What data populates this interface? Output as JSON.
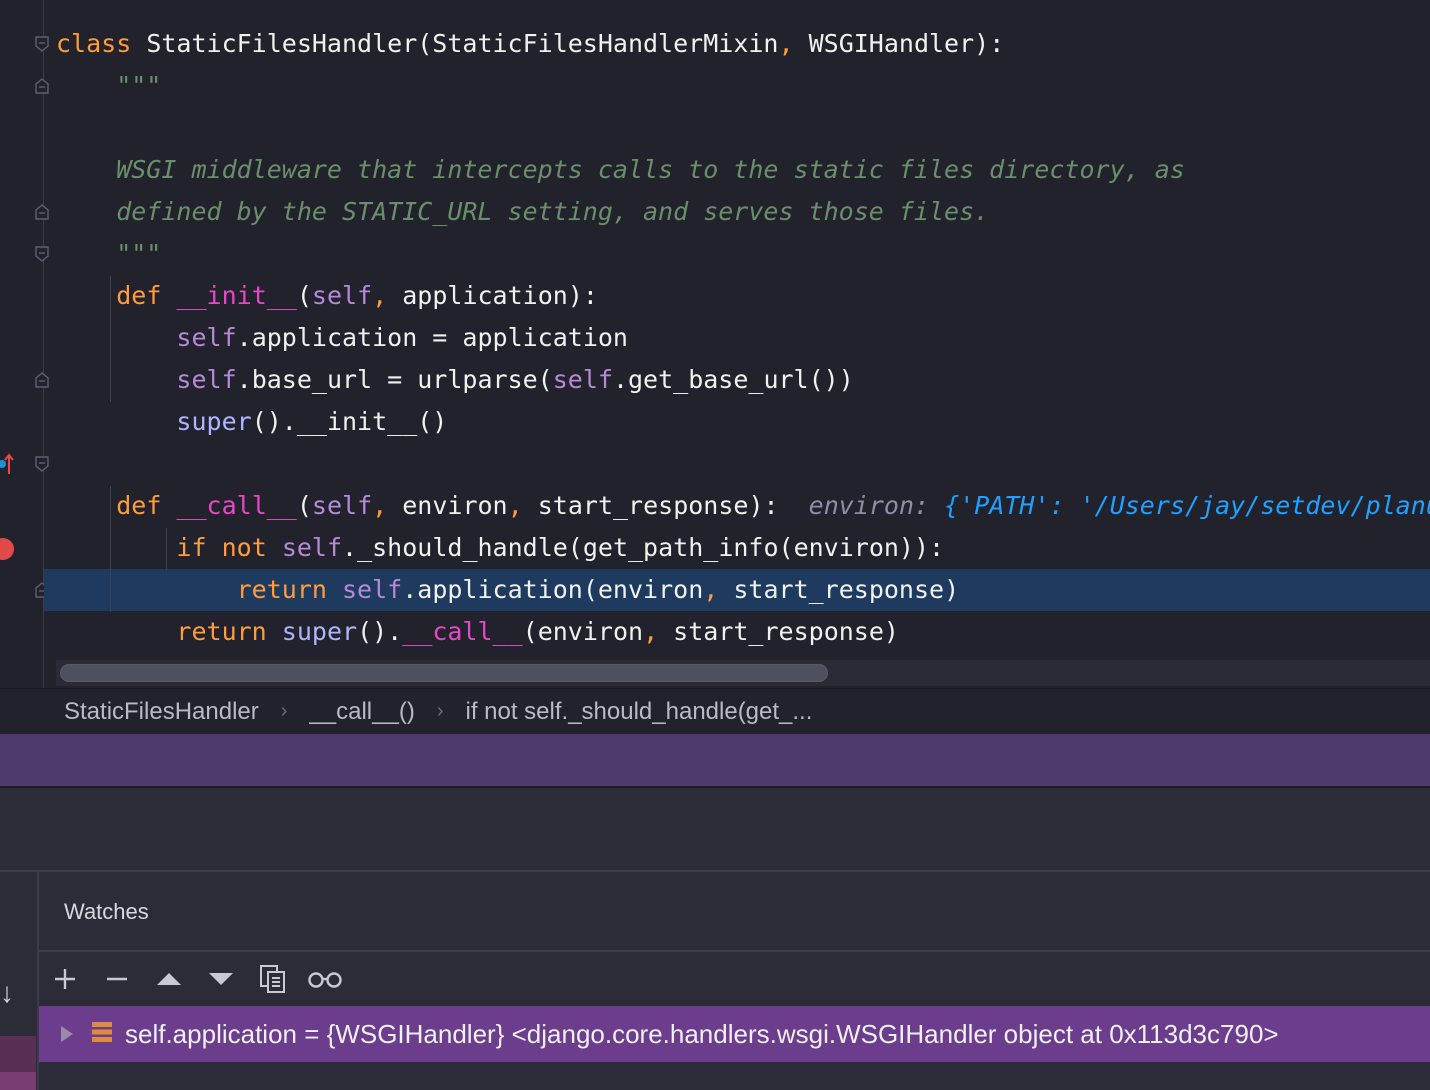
{
  "editor": {
    "lines": [
      [
        {
          "t": "class",
          "c": "kw"
        },
        {
          "t": " StaticFilesHandler(StaticFilesHandlerMixin"
        },
        {
          "t": ",",
          "c": "comma"
        },
        {
          "t": " WSGIHandler):"
        }
      ],
      [
        {
          "t": "    \"\"\"",
          "c": "doc"
        }
      ],
      [],
      [
        {
          "t": "    WSGI middleware that intercepts calls to the static files directory, as",
          "c": "doc"
        }
      ],
      [
        {
          "t": "    defined by the STATIC_URL setting, and serves those files.",
          "c": "doc"
        }
      ],
      [
        {
          "t": "    \"\"\"",
          "c": "doc"
        }
      ],
      [
        {
          "t": "    "
        },
        {
          "t": "def",
          "c": "kw"
        },
        {
          "t": " "
        },
        {
          "t": "__init__",
          "c": "dunder"
        },
        {
          "t": "("
        },
        {
          "t": "self",
          "c": "self"
        },
        {
          "t": ",",
          "c": "comma"
        },
        {
          "t": " application):"
        }
      ],
      [
        {
          "t": "        "
        },
        {
          "t": "self",
          "c": "self"
        },
        {
          "t": ".application = application"
        }
      ],
      [
        {
          "t": "        "
        },
        {
          "t": "self",
          "c": "self"
        },
        {
          "t": ".base_url = urlparse("
        },
        {
          "t": "self",
          "c": "self"
        },
        {
          "t": ".get_base_url())"
        }
      ],
      [
        {
          "t": "        "
        },
        {
          "t": "super",
          "c": "builtin"
        },
        {
          "t": "().__init__()"
        }
      ],
      [],
      [
        {
          "t": "    "
        },
        {
          "t": "def",
          "c": "kw"
        },
        {
          "t": " "
        },
        {
          "t": "__call__",
          "c": "dunder"
        },
        {
          "t": "("
        },
        {
          "t": "self",
          "c": "self"
        },
        {
          "t": ",",
          "c": "comma"
        },
        {
          "t": " environ"
        },
        {
          "t": ",",
          "c": "comma"
        },
        {
          "t": " start_response):  "
        },
        {
          "t": "environ: ",
          "c": "inline-hint-label"
        },
        {
          "t": "{'PATH': '/Users/jay/setdev/planus-serv",
          "c": "inline-hint-val"
        }
      ],
      [
        {
          "t": "        "
        },
        {
          "t": "if",
          "c": "kw"
        },
        {
          "t": " "
        },
        {
          "t": "not",
          "c": "kw"
        },
        {
          "t": " "
        },
        {
          "t": "self",
          "c": "self"
        },
        {
          "t": "._should_handle(get_path_info(environ)):"
        }
      ],
      [
        {
          "t": "            "
        },
        {
          "t": "return",
          "c": "kw"
        },
        {
          "t": " "
        },
        {
          "t": "self",
          "c": "self"
        },
        {
          "t": ".application(environ"
        },
        {
          "t": ",",
          "c": "comma"
        },
        {
          "t": " start_response)"
        }
      ],
      [
        {
          "t": "        "
        },
        {
          "t": "return",
          "c": "kw"
        },
        {
          "t": " "
        },
        {
          "t": "super",
          "c": "builtin"
        },
        {
          "t": "()."
        },
        {
          "t": "__call__",
          "c": "dunder"
        },
        {
          "t": "(environ"
        },
        {
          "t": ",",
          "c": "comma"
        },
        {
          "t": " start_response)"
        }
      ]
    ]
  },
  "breadcrumb": {
    "items": [
      "StaticFilesHandler",
      "__call__()",
      "if not self._should_handle(get_..."
    ],
    "separator": "›"
  },
  "watches": {
    "title": "Watches",
    "toolbar": [
      "add-icon",
      "remove-icon",
      "move-up-icon",
      "move-down-icon",
      "copy-icon",
      "glasses-icon"
    ],
    "row_text": "self.application = {WSGIHandler} <django.core.handlers.wsgi.WSGIHandler object at 0x113d3c790>"
  },
  "colors": {
    "keyword": "#ff9c3b",
    "self": "#b78ad8",
    "dunder": "#e648c7",
    "docstring": "#6a8f6a",
    "exec_line": "#1e3a5f",
    "watch_selected": "#6c3d8c",
    "banner": "#4f3a6e"
  }
}
